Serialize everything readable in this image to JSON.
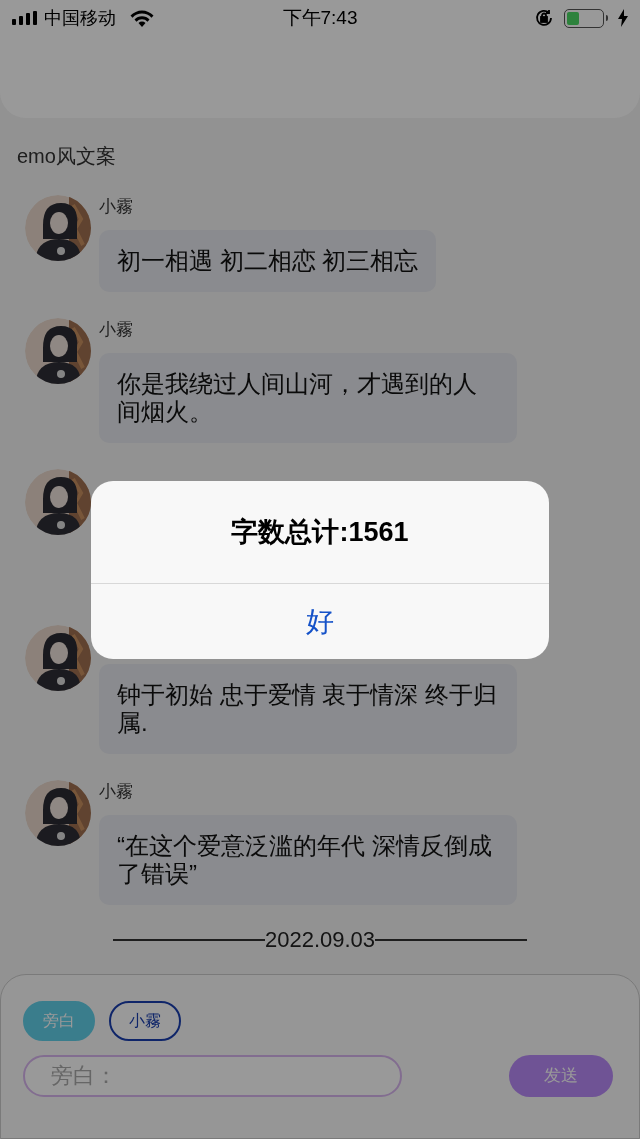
{
  "status_bar": {
    "carrier": "中国移动",
    "time": "下午7:43",
    "charging": true
  },
  "title": "emo风文案",
  "messages": [
    {
      "kind": "text",
      "sender": "小霧",
      "text": "初一相遇 初二相恋 初三相忘"
    },
    {
      "kind": "text",
      "sender": "小霧",
      "text": "你是我绕过人间山河，才遇到的人间烟火。"
    },
    {
      "kind": "covered"
    },
    {
      "kind": "avatar_only",
      "text": "钟于初始 忠于爱情 衷于情深 终于归属."
    },
    {
      "kind": "text",
      "sender": "小霧",
      "text": "“在这个爱意泛滥的年代 深情反倒成了错误”"
    }
  ],
  "date_divider": "2022.09.03",
  "composer": {
    "roles": [
      {
        "label": "旁白",
        "selected": true
      },
      {
        "label": "小霧",
        "selected": false
      }
    ],
    "placeholder": "旁白：",
    "send": "发送"
  },
  "alert": {
    "message": "字数总计:1561",
    "button": "好"
  }
}
